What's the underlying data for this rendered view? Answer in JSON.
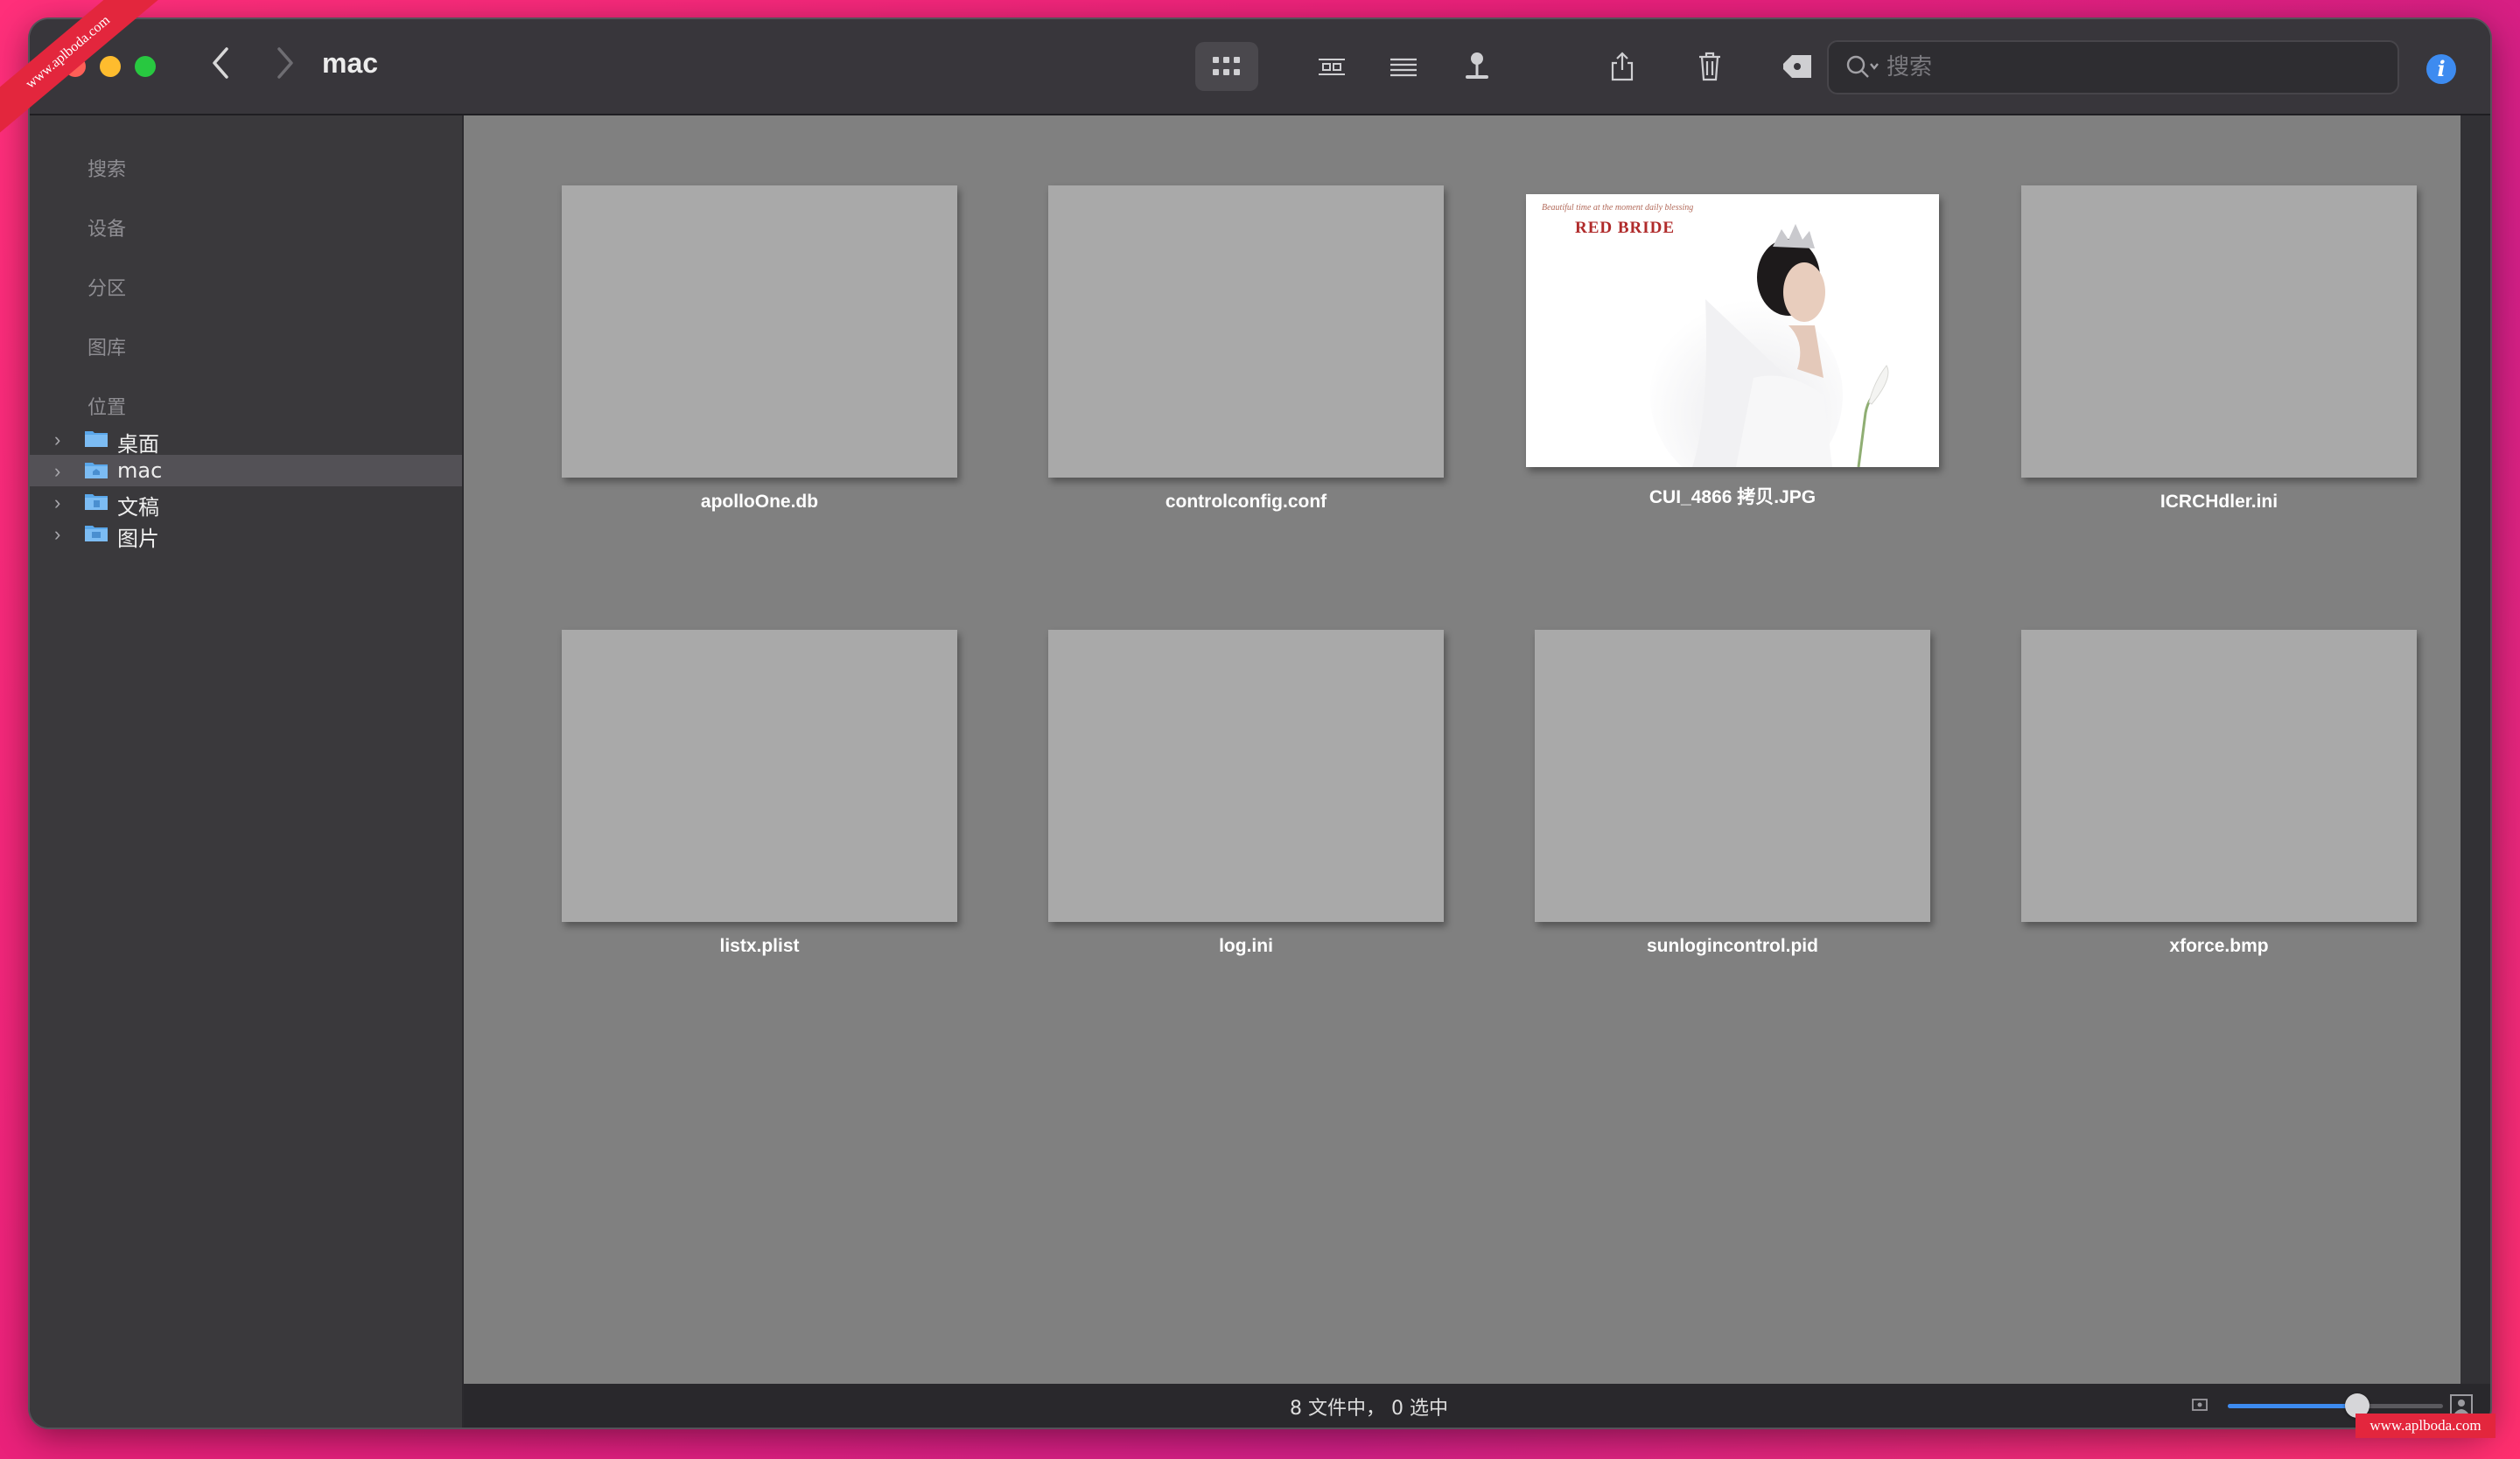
{
  "window": {
    "title": "mac",
    "toolbar": {
      "search_placeholder": "搜索"
    }
  },
  "sidebar": {
    "sections": [
      "搜索",
      "设备",
      "分区",
      "图库",
      "位置"
    ],
    "locations": [
      {
        "label": "桌面",
        "selected": false
      },
      {
        "label": "mac",
        "selected": true
      },
      {
        "label": "文稿",
        "selected": false
      },
      {
        "label": "图片",
        "selected": false
      }
    ]
  },
  "files": [
    {
      "name": "apolloOne.db",
      "thumbnail": "blank"
    },
    {
      "name": "controlconfig.conf",
      "thumbnail": "blank"
    },
    {
      "name": "CUI_4866 拷贝.JPG",
      "thumbnail": "photo"
    },
    {
      "name": "ICRCHdler.ini",
      "thumbnail": "blank"
    },
    {
      "name": "listx.plist",
      "thumbnail": "blank"
    },
    {
      "name": "log.ini",
      "thumbnail": "blank"
    },
    {
      "name": "sunlogincontrol.pid",
      "thumbnail": "blank"
    },
    {
      "name": "xforce.bmp",
      "thumbnail": "blank"
    }
  ],
  "photo": {
    "title": "RED BRIDE",
    "script": "Beautiful time at the moment daily blessing"
  },
  "statusbar": {
    "text": "8 文件中， 0 选中",
    "zoom_level": 0.6
  },
  "watermark": {
    "corner": "www.aplboda.com",
    "bottom": "www.aplboda.com"
  },
  "colors": {
    "accent": "#3d8bf0",
    "background": "#ff2f7a"
  }
}
